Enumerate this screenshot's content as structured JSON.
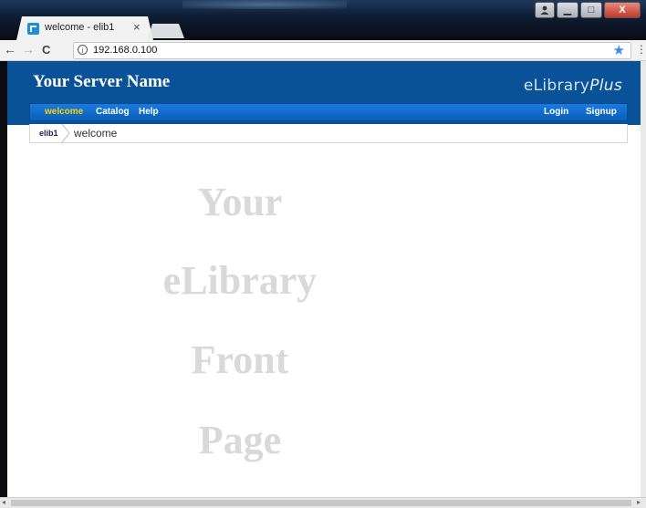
{
  "browser": {
    "tab_title": "welcome - elib1",
    "tab_close": "×",
    "url": "192.168.0.100",
    "nav": {
      "back": "←",
      "forward": "→",
      "reload": "C"
    },
    "info_glyph": "i",
    "bookmark_glyph": "★",
    "menu_glyph": "⋮"
  },
  "window_controls": {
    "minimize": "▁",
    "maximize": "□",
    "close": "X"
  },
  "site": {
    "server_name": "Your Server Name",
    "brand_main": "eLibrary",
    "brand_plus": "Plus",
    "nav_left": [
      "welcome",
      "Catalog",
      "Help"
    ],
    "nav_right": [
      "Login",
      "Signup"
    ],
    "breadcrumb_home": "elib1",
    "breadcrumb_current": "welcome",
    "front_lines": [
      "Your",
      "eLibrary",
      "Front",
      "Page"
    ]
  },
  "colors": {
    "header_bg": "#0a5298",
    "nav_active": "#ffd200",
    "placeholder_text": "#d9d9d9"
  }
}
